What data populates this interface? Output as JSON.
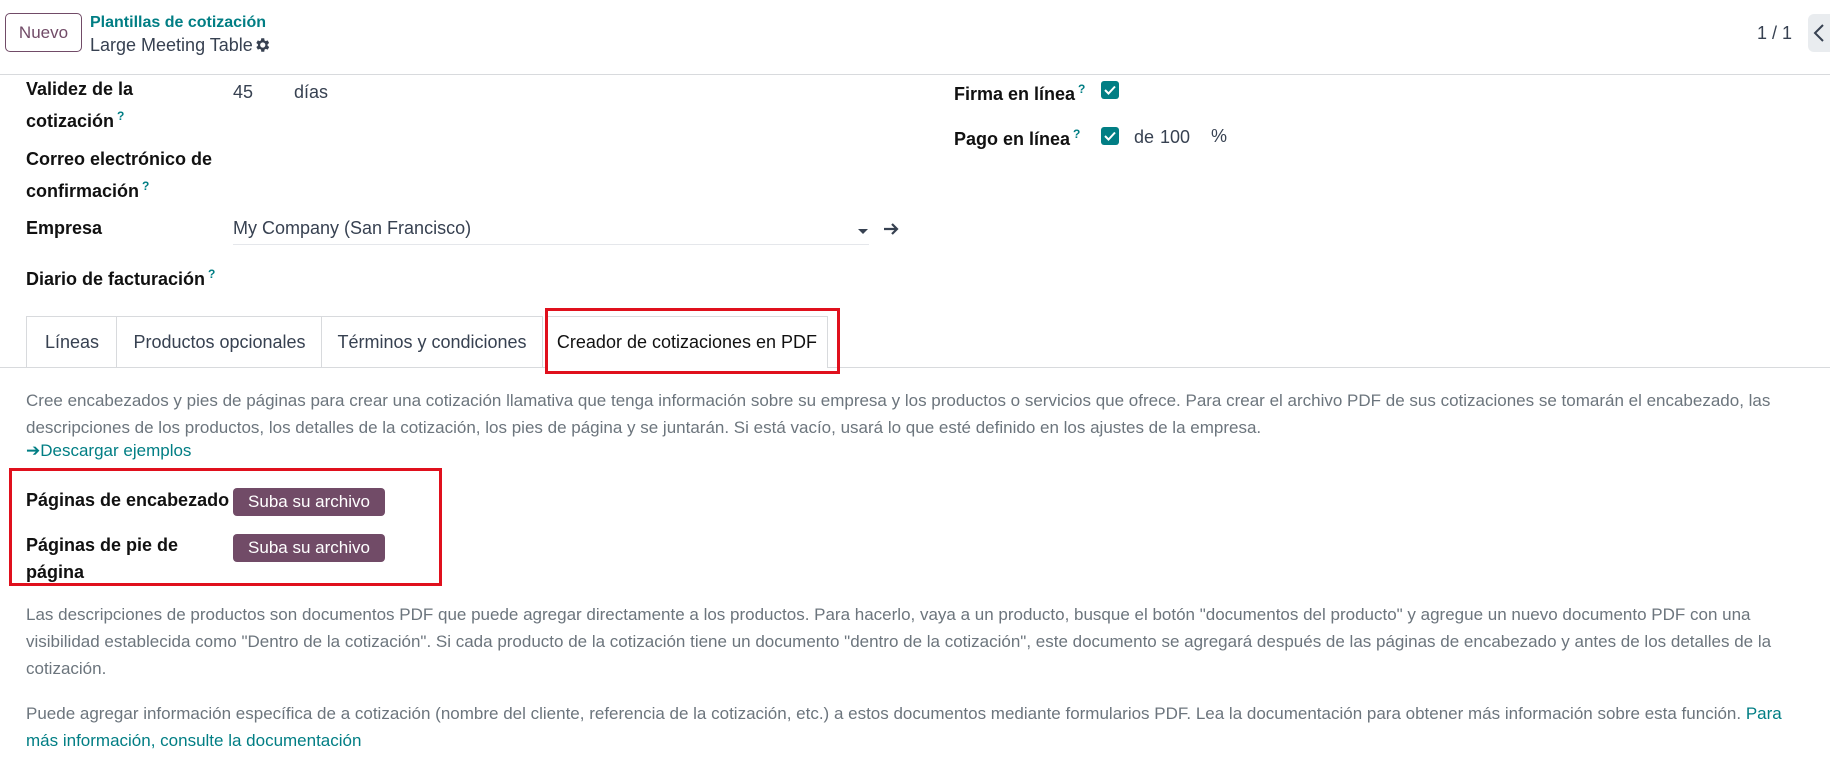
{
  "header": {
    "new_button": "Nuevo",
    "breadcrumb_parent": "Plantillas de cotización",
    "record_name": "Large Meeting Table",
    "pager": "1 / 1"
  },
  "form": {
    "validity_label_1": "Validez de la",
    "validity_label_2": "cotización",
    "validity_value": "45",
    "validity_unit": "días",
    "email_label_1": "Correo electrónico de",
    "email_label_2": "confirmación",
    "company_label": "Empresa",
    "company_value": "My Company (San Francisco)",
    "journal_label": "Diario de facturación",
    "signature_label": "Firma en línea",
    "payment_label": "Pago en línea",
    "payment_prefix": "de",
    "payment_value": "100",
    "payment_unit": "%",
    "help_mark": "?"
  },
  "tabs": [
    "Líneas",
    "Productos opcionales",
    "Términos y condiciones",
    "Creador de cotizaciones en PDF"
  ],
  "pdf": {
    "intro": "Cree encabezados y pies de páginas para crear una cotización llamativa que tenga información sobre su empresa y los productos o servicios que ofrece. Para crear el archivo PDF de sus cotizaciones se tomarán el encabezado, las descripciones de los productos, los detalles de la cotización, los pies de página y se juntarán. Si está vacío, usará lo que esté definido en los ajustes de la empresa.",
    "download_link": "Descargar ejemplos",
    "header_pages_label": "Páginas de encabezado",
    "footer_pages_label_1": "Páginas de pie de",
    "footer_pages_label_2": "página",
    "upload_label": "Suba su archivo",
    "product_docs_text": "Las descripciones de productos son documentos PDF que puede agregar directamente a los productos. Para hacerlo, vaya a un producto, busque el botón \"documentos del producto\" y agregue un nuevo documento PDF con una visibilidad establecida como \"Dentro de la cotización\". Si cada producto de la cotización tiene un documento \"dentro de la cotización\", este documento se agregará después de las páginas de encabezado y antes de los detalles de la cotización.",
    "forms_text": "Puede agregar información específica de a cotización (nombre del cliente, referencia de la cotización, etc.) a estos documentos mediante formularios PDF. Lea la documentación para obtener más información sobre esta función.",
    "doc_link": "Para más información, consulte la documentación"
  },
  "colors": {
    "brand": "#714b67",
    "accent": "#017e84",
    "highlight": "#e0101d"
  }
}
